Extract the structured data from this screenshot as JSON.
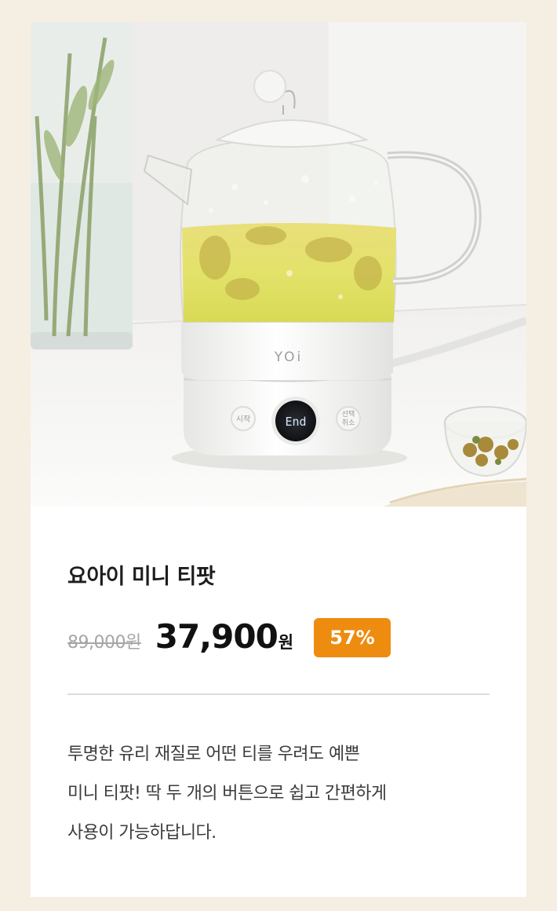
{
  "product": {
    "image_alt": "yoi mini tea pot",
    "brand_mark": "YOi",
    "button_left": "시작",
    "button_right_line1": "선택",
    "button_right_line2": "취소",
    "display_text": "End",
    "title": "요아이 미니 티팟",
    "original_price": "89,000원",
    "sale_price": "37,900",
    "currency": "원",
    "discount": "57%",
    "description_lines": [
      "투명한 유리 재질로 어떤 티를 우려도 예쁜",
      "미니 티팟! 딱 두 개의 버튼으로 쉽고 간편하게",
      "사용이 가능하답니다."
    ]
  },
  "colors": {
    "page_bg": "#f5eee2",
    "card_bg": "#ffffff",
    "badge": "#ee8c10",
    "divider": "#dcdcdc"
  }
}
